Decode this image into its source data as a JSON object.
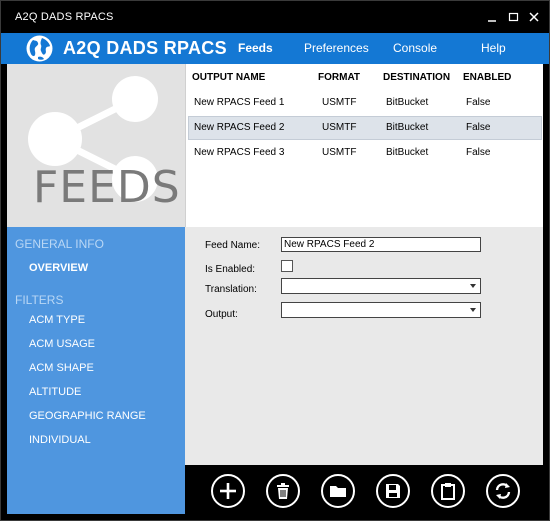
{
  "window": {
    "title": "A2Q DADS RPACS"
  },
  "header": {
    "app_name": "A2Q DADS RPACS",
    "nav": [
      "Feeds",
      "Preferences",
      "Console",
      "Help"
    ]
  },
  "hero": {
    "label": "FEEDS"
  },
  "sidebar": {
    "general_title": "GENERAL INFO",
    "general_items": [
      "OVERVIEW"
    ],
    "filters_title": "FILTERS",
    "filter_items": [
      "ACM TYPE",
      "ACM USAGE",
      "ACM SHAPE",
      "ALTITUDE",
      "GEOGRAPHIC RANGE",
      "INDIVIDUAL"
    ]
  },
  "grid": {
    "columns": [
      "OUTPUT NAME",
      "FORMAT",
      "DESTINATION",
      "ENABLED"
    ],
    "rows": [
      [
        "New RPACS Feed 1",
        "USMTF",
        "BitBucket",
        "False"
      ],
      [
        "New RPACS Feed 2",
        "USMTF",
        "BitBucket",
        "False"
      ],
      [
        "New RPACS Feed 3",
        "USMTF",
        "BitBucket",
        "False"
      ]
    ],
    "selected_row": 1
  },
  "form": {
    "feed_name_label": "Feed Name:",
    "feed_name_value": "New RPACS Feed 2",
    "is_enabled_label": "Is Enabled:",
    "translation_label": "Translation:",
    "output_label": "Output:"
  },
  "toolbar": {
    "buttons": [
      "add-icon",
      "delete-icon",
      "folder-icon",
      "save-icon",
      "clipboard-icon",
      "refresh-icon"
    ]
  },
  "colors": {
    "accent": "#1478d4",
    "sidebar": "#4f96df",
    "selected_row": "#dde3ea"
  }
}
